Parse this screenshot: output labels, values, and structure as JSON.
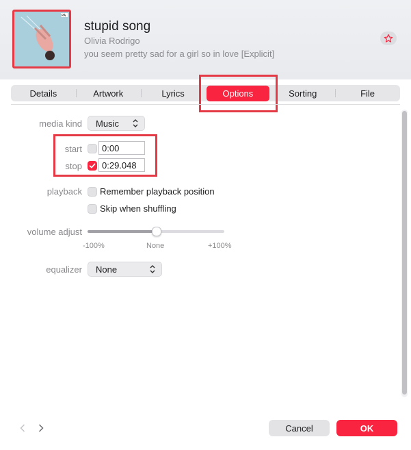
{
  "header": {
    "title": "stupid song",
    "artist": "Olivia Rodrigo",
    "album": "you seem pretty sad for a girl so in love [Explicit]",
    "artwork_icon": "album-artwork",
    "favorite_icon": "star-icon"
  },
  "tabs": [
    {
      "label": "Details"
    },
    {
      "label": "Artwork"
    },
    {
      "label": "Lyrics"
    },
    {
      "label": "Options",
      "active": true
    },
    {
      "label": "Sorting"
    },
    {
      "label": "File"
    }
  ],
  "options": {
    "media_kind_label": "media kind",
    "media_kind_value": "Music",
    "start_label": "start",
    "start_value": "0:00",
    "start_checked": false,
    "stop_label": "stop",
    "stop_value": "0:29.048",
    "stop_checked": true,
    "playback_label": "playback",
    "remember_label": "Remember playback position",
    "remember_checked": false,
    "skip_label": "Skip when shuffling",
    "skip_checked": false,
    "volume_label": "volume adjust",
    "volume_min": "-100%",
    "volume_mid": "None",
    "volume_max": "+100%",
    "volume_value": 0,
    "equalizer_label": "equalizer",
    "equalizer_value": "None"
  },
  "footer": {
    "prev_icon": "chevron-left-icon",
    "next_icon": "chevron-right-icon",
    "cancel_label": "Cancel",
    "ok_label": "OK"
  },
  "colors": {
    "accent": "#f9243f",
    "callout": "#e53a45"
  }
}
